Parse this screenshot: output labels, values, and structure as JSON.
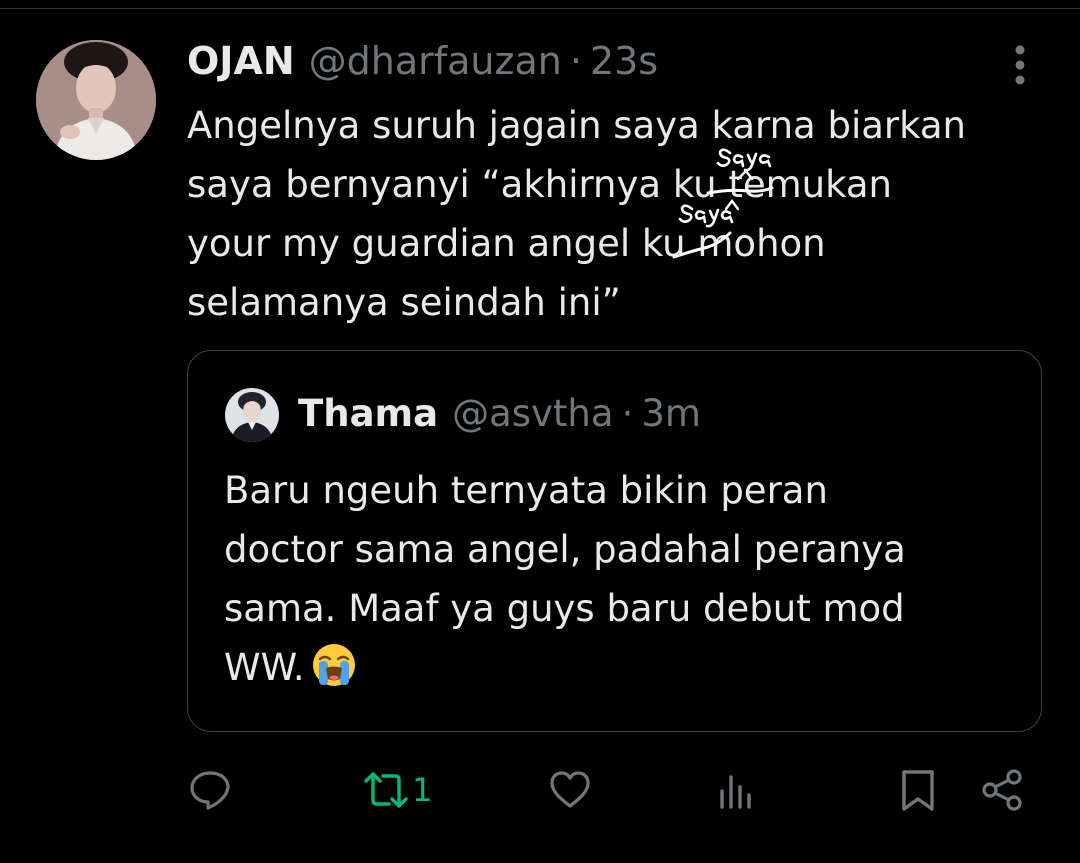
{
  "tweet": {
    "display_name": "OJAN",
    "handle": "@dharfauzan",
    "separator": "·",
    "time": "23s",
    "text_lines": [
      "Angelnya suruh jagain saya karna biarkan",
      "saya bernyanyi “akhirnya ku temukan",
      "your my guardian angel ku mohon",
      "selamanya seindah ini”"
    ],
    "handwritten_corrections": [
      "saya",
      "saya"
    ]
  },
  "quoted_tweet": {
    "display_name": "Thama",
    "handle": "@asvtha",
    "separator": "·",
    "time": "3m",
    "text_lines": [
      "Baru ngeuh ternyata bikin peran",
      "doctor sama angel, padahal peranya",
      "sama. Maaf ya guys baru debut mod",
      "WW."
    ],
    "emoji": "loudly-crying-face"
  },
  "actions": {
    "reply_icon": "reply-icon",
    "retweet_icon": "retweet-icon",
    "retweet_count": "1",
    "like_icon": "heart-icon",
    "views_icon": "views-icon",
    "bookmark_icon": "bookmark-icon",
    "share_icon": "share-icon"
  },
  "colors": {
    "background": "#000000",
    "text_primary": "#e7e9ea",
    "text_secondary": "#71767b",
    "border": "#3e4144",
    "retweet_active": "#00ba7c"
  }
}
